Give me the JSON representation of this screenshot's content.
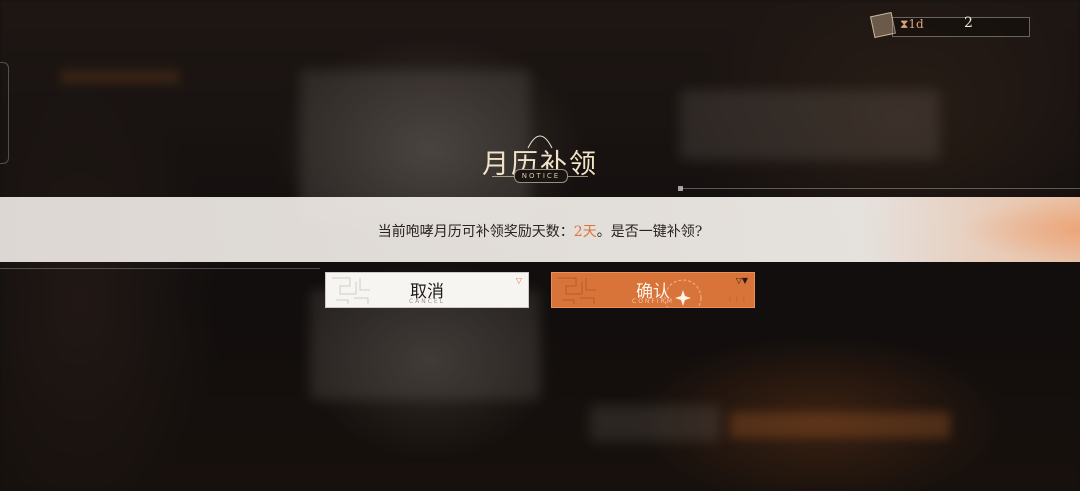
{
  "topbar": {
    "timer": "⧗1d",
    "count": "2"
  },
  "dialog": {
    "title": "月历补领",
    "subtitle": "NOTICE",
    "message_prefix": "当前咆哮月历可补领奖励天数：",
    "message_days": "2天",
    "message_suffix": "。是否一键补领?"
  },
  "buttons": {
    "cancel_label": "取消",
    "cancel_sub": "CANCEL",
    "confirm_label": "确认",
    "confirm_sub": "CONFIRM"
  },
  "colors": {
    "accent": "#d8733a",
    "highlight": "#e0733a",
    "title": "#f2e3c8"
  }
}
